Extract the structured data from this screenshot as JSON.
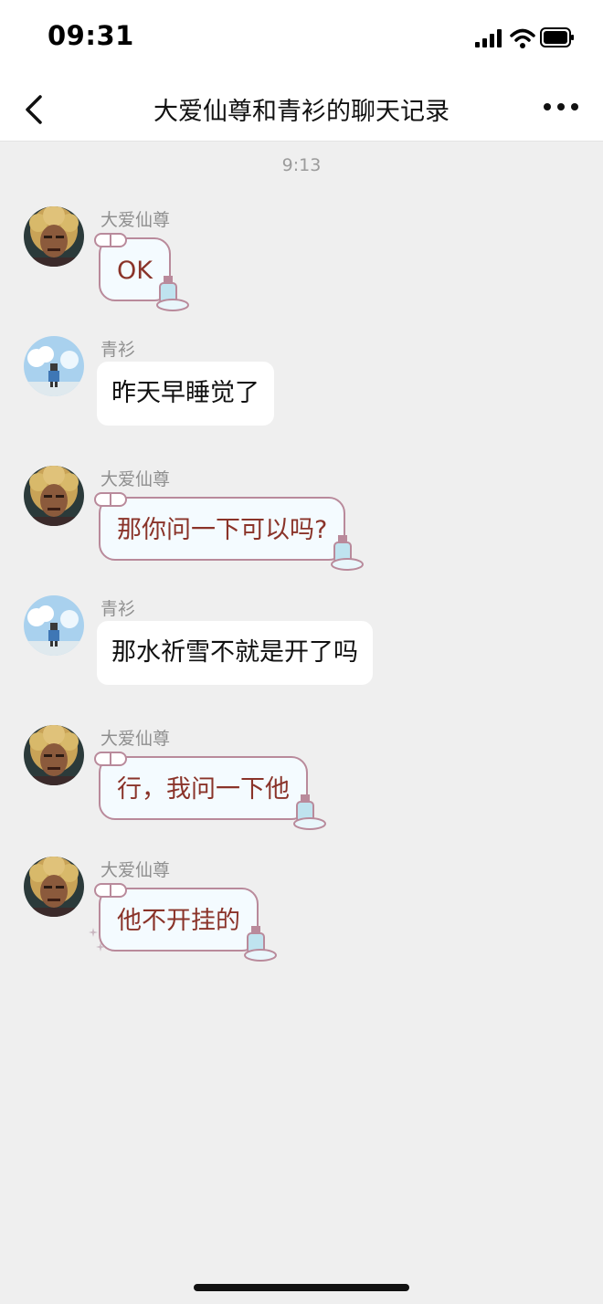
{
  "status_bar": {
    "time": "09:31"
  },
  "nav": {
    "title": "大爱仙尊和青衫的聊天记录"
  },
  "timestamp": "9:13",
  "messages": [
    {
      "sender": "大爱仙尊",
      "text": "OK",
      "style": "decorated",
      "avatar": "warrior-avatar"
    },
    {
      "sender": "青衫",
      "text": "昨天早睡觉了",
      "style": "plain",
      "avatar": "sky-avatar"
    },
    {
      "sender": "大爱仙尊",
      "text": "那你问一下可以吗?",
      "style": "decorated",
      "avatar": "warrior-avatar"
    },
    {
      "sender": "青衫",
      "text": "那水祈雪不就是开了吗",
      "style": "plain",
      "avatar": "sky-avatar"
    },
    {
      "sender": "大爱仙尊",
      "text": "行，我问一下他",
      "style": "decorated",
      "avatar": "warrior-avatar"
    },
    {
      "sender": "大爱仙尊",
      "text": "他不开挂的",
      "style": "decorated",
      "avatar": "warrior-avatar"
    }
  ],
  "colors": {
    "background": "#efefef",
    "decorated_text": "#8a3329",
    "decorated_border": "#b98a9b"
  }
}
